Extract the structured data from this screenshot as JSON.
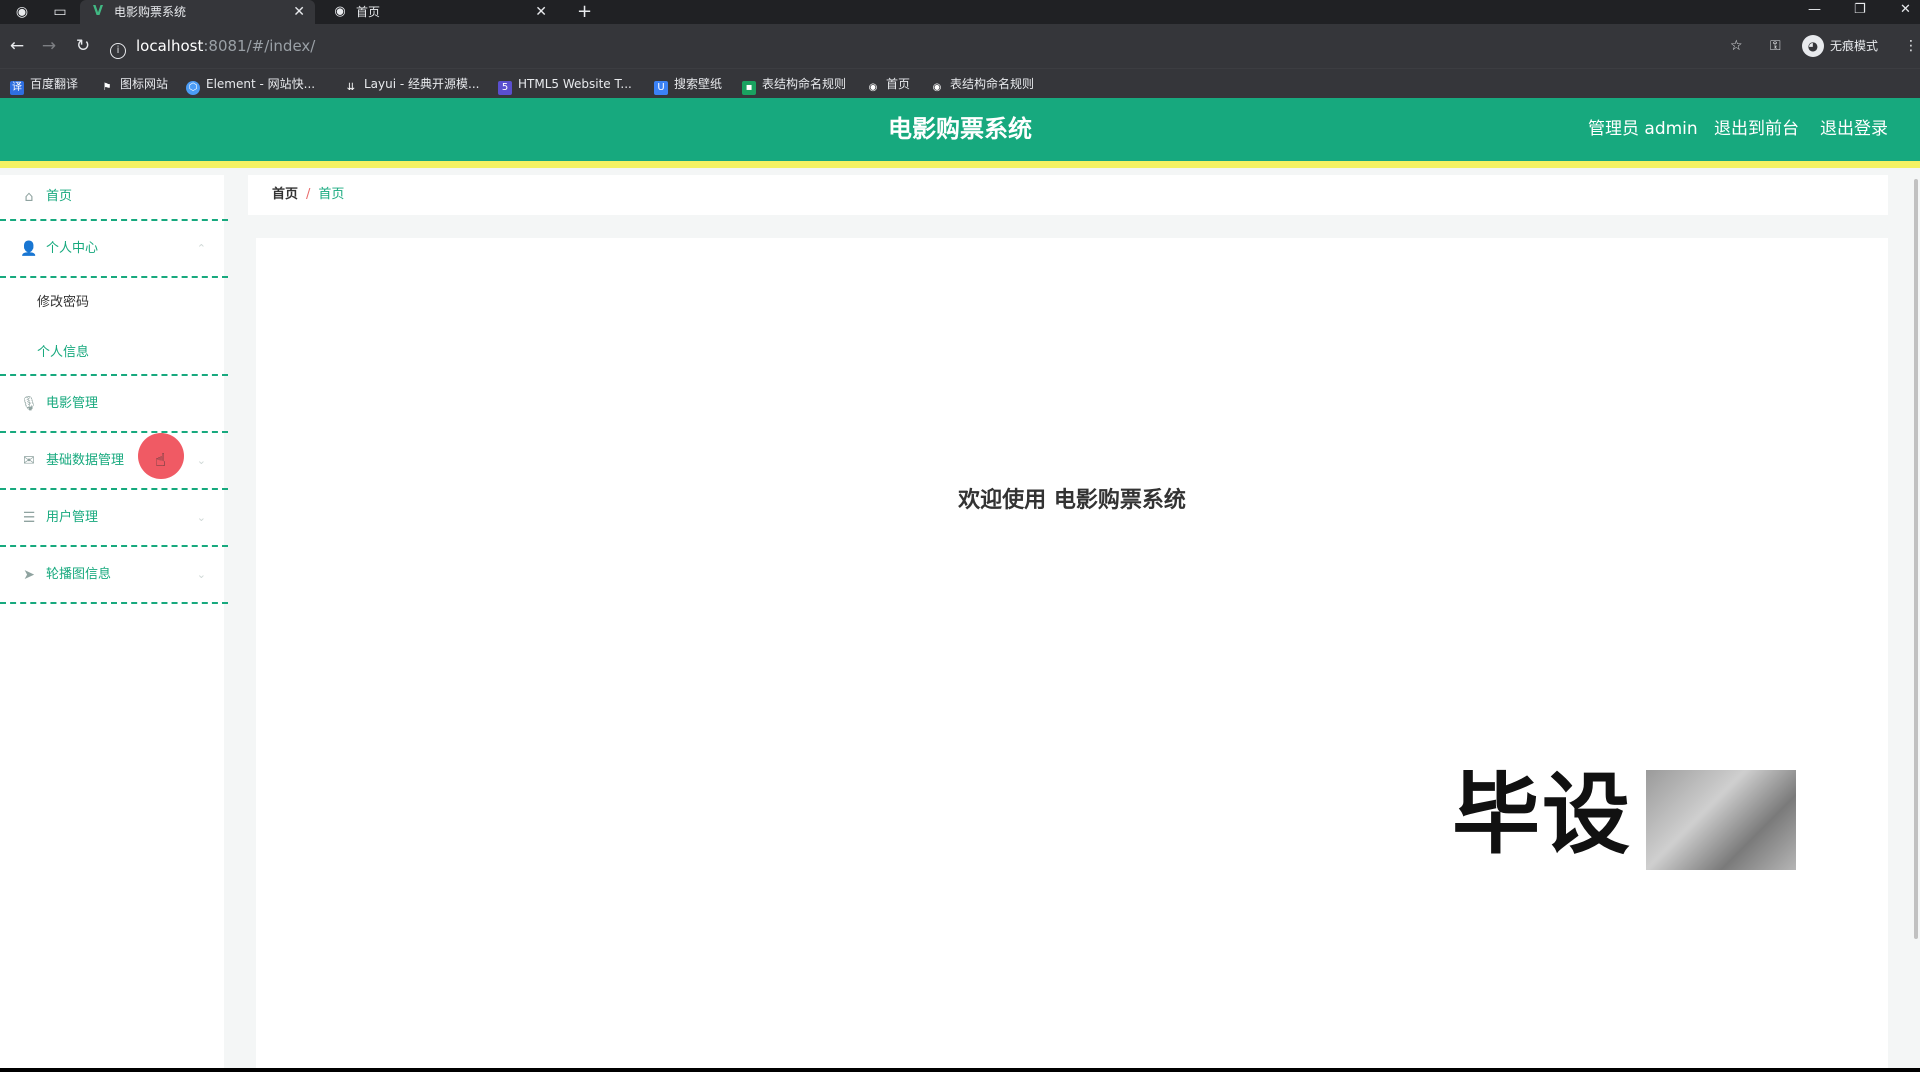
{
  "browser": {
    "tabs": [
      {
        "title": "电影购票系统",
        "active": true
      },
      {
        "title": "首页",
        "active": false
      }
    ],
    "new_tab": "+",
    "address": {
      "host": "localhost",
      "rest": ":8081/#/index/"
    },
    "profile_label": "无痕模式",
    "bookmarks": [
      {
        "label": "百度翻译",
        "color": "#2f6fe0"
      },
      {
        "label": "图标网站",
        "color": "#ffffff"
      },
      {
        "label": "Element - 网站快...",
        "color": "#4b9cf5"
      },
      {
        "label": "Layui - 经典开源模...",
        "color": "#cccccc"
      },
      {
        "label": "HTML5 Website T...",
        "color": "#5a4fcf"
      },
      {
        "label": "搜索壁纸",
        "color": "#3b82f6"
      },
      {
        "label": "表结构命名规则",
        "color": "#1aa260"
      },
      {
        "label": "首页",
        "color": "#e8eaed"
      },
      {
        "label": "表结构命名规则",
        "color": "#e8eaed"
      }
    ]
  },
  "header": {
    "title": "电影购票系统",
    "admin_label": "管理员 admin",
    "back_label": "退出到前台",
    "logout_label": "退出登录",
    "accent": "#17a97e",
    "stripe": "#f5f262"
  },
  "sidebar": {
    "items": [
      {
        "label": "首页",
        "icon": "home-icon"
      },
      {
        "label": "个人中心",
        "icon": "user-icon"
      },
      {
        "label": "电影管理",
        "icon": "mic-icon"
      },
      {
        "label": "基础数据管理",
        "icon": "mail-icon"
      },
      {
        "label": "用户管理",
        "icon": "list-icon"
      },
      {
        "label": "轮播图信息",
        "icon": "send-icon"
      }
    ],
    "sub_items": [
      {
        "label": "修改密码"
      },
      {
        "label": "个人信息"
      }
    ]
  },
  "breadcrumb": {
    "root": "首页",
    "separator": "/",
    "current": "首页"
  },
  "main": {
    "welcome": "欢迎使用 电影购票系统"
  },
  "watermark": {
    "text": "毕设"
  }
}
